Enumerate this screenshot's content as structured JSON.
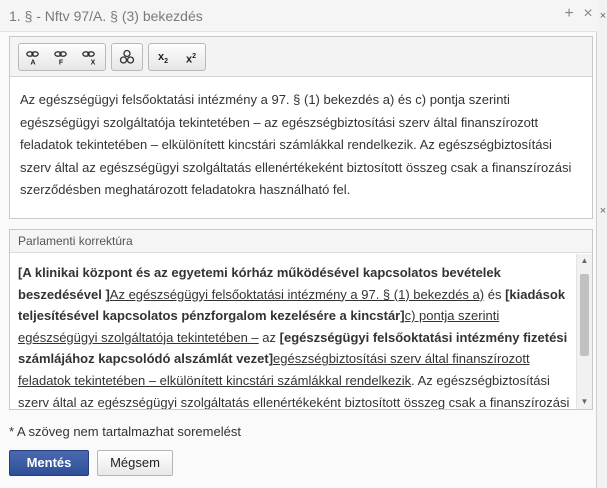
{
  "dialog": {
    "title": "1. § - Nftv 97/A. § (3) bekezdés",
    "maximize_glyph": "+",
    "close_glyph": "×"
  },
  "side": {
    "close_glyph_1": "×",
    "close_glyph_2": "×"
  },
  "toolbar": {
    "buttons": [
      {
        "name": "link-anchor-icon",
        "sub": "A"
      },
      {
        "name": "link-footnote-icon",
        "sub": "F"
      },
      {
        "name": "link-remove-icon",
        "sub": "X"
      },
      {
        "name": "group-icon"
      },
      {
        "name": "subscript-icon",
        "label": "x",
        "mark": "2"
      },
      {
        "name": "superscript-icon",
        "label": "x",
        "mark": "2"
      }
    ]
  },
  "editor": {
    "text": "Az egészségügyi felsőoktatási intézmény a 97. § (1) bekezdés a) és c) pontja szerinti egészségügyi szolgáltatója tekintetében – az egészségbiztosítási szerv által finanszírozott feladatok tekintetében – elkülönített kincstári számlákkal rendelkezik. Az egészségbiztosítási szerv által az egészségügyi szolgáltatás ellenértékeként biztosított összeg csak a finanszírozási szerződésben meghatározott feladatokra használható fel."
  },
  "correction": {
    "title": "Parlamenti korrektúra",
    "segments": [
      {
        "style": "bold",
        "text": "[A klinikai központ és az egyetemi kórház működésével kapcsolatos bevételek beszedésével ]"
      },
      {
        "style": "underline",
        "text": "Az egészségügyi felsőoktatási intézmény a 97. § (1) bekezdés a)"
      },
      {
        "style": "plain",
        "text": " és "
      },
      {
        "style": "bold",
        "text": "[kiadások teljesítésével kapcsolatos pénzforgalom kezelésére a kincstár]"
      },
      {
        "style": "underline",
        "text": "c) pontja szerinti egészségügyi szolgáltatója tekintetében –"
      },
      {
        "style": "plain",
        "text": " az "
      },
      {
        "style": "bold",
        "text": "[egészségügyi felsőoktatási intézmény fizetési számlájához kapcsolódó alszámlát vezet]"
      },
      {
        "style": "underline",
        "text": "egészségbiztosítási szerv által finanszírozott feladatok tekintetében – elkülönített kincstári számlákkal rendelkezik"
      },
      {
        "style": "plain",
        "text": ". Az egészségbiztosítási szerv által az egészségügyi szolgáltatás ellenértékeként biztosított összeg csak a finanszírozási szerződésben meghatározott feladatokra használható fel."
      }
    ]
  },
  "footer": {
    "note": "* A szöveg nem tartalmazhat soremelést",
    "save_label": "Mentés",
    "cancel_label": "Mégsem"
  },
  "colors": {
    "primary": "#2e4f98",
    "title_text": "#7a7a7a"
  }
}
